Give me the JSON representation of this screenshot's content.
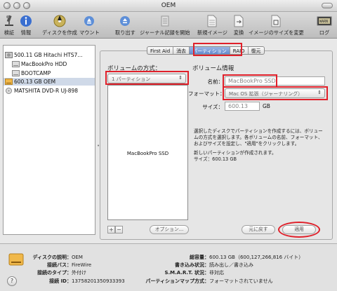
{
  "window": {
    "title": "OEM"
  },
  "toolbar": {
    "items": [
      {
        "label": "検証",
        "icon": "microscope-icon"
      },
      {
        "label": "情報",
        "icon": "info-icon"
      },
      {
        "label": "ディスクを作成",
        "icon": "burn-icon"
      },
      {
        "label": "マウント",
        "icon": "mount-icon"
      },
      {
        "label": "取り出す",
        "icon": "eject-icon"
      },
      {
        "label": "ジャーナル記録を開始",
        "icon": "journal-icon"
      },
      {
        "label": "新規イメージ",
        "icon": "new-image-icon"
      },
      {
        "label": "変換",
        "icon": "convert-icon"
      },
      {
        "label": "イメージのサイズを変更",
        "icon": "resize-image-icon"
      },
      {
        "label": "ログ",
        "icon": "log-icon"
      }
    ]
  },
  "sidebar": {
    "items": [
      {
        "label": "500.11 GB Hitachi HTS7...",
        "icon": "hard-disk-icon",
        "selected": false
      },
      {
        "label": "MacBookPro HDD",
        "icon": "volume-icon",
        "selected": false
      },
      {
        "label": "BOOTCAMP",
        "icon": "volume-icon",
        "selected": false
      },
      {
        "label": "600.13 GB OEM",
        "icon": "external-disk-icon",
        "selected": true
      },
      {
        "label": "MATSHITA DVD-R UJ-898",
        "icon": "optical-drive-icon",
        "selected": false
      }
    ]
  },
  "tabs": [
    {
      "label": "First Aid",
      "active": false
    },
    {
      "label": "消去",
      "active": false
    },
    {
      "label": "パーティション",
      "active": true
    },
    {
      "label": "RAID",
      "active": false
    },
    {
      "label": "復元",
      "active": false
    }
  ],
  "partition": {
    "scheme_heading": "ボリュームの方式：",
    "scheme_value": "1 パーティション",
    "volume_label": "MacBookPro SSD",
    "info_heading": "ボリューム情報",
    "name_label": "名前：",
    "name_value": "MacBookPro SSD",
    "format_label": "フォーマット：",
    "format_value": "Mac OS 拡張（ジャーナリング）",
    "size_label": "サイズ：",
    "size_value": "600.13",
    "size_unit": "GB",
    "help_text_1": "選択したディスクでパーティションを作成するには、ボリュームの方式を選択します。各ボリュームの名前、フォーマット、およびサイズを設定し、\"適用\"をクリックします。",
    "help_text_2": "新しいパーティションが作成されます。\nサイズ：600.13 GB",
    "add_label": "+",
    "remove_label": "−",
    "options_label": "オプション...",
    "revert_label": "元に戻す",
    "apply_label": "適用"
  },
  "disk_info": {
    "description_label": "ディスクの説明：",
    "description_value": "OEM",
    "connection_bus_label": "接続バス：",
    "connection_bus_value": "FireWire",
    "connection_type_label": "接続のタイプ：",
    "connection_type_value": "外付け",
    "connection_id_label": "接続 ID：",
    "connection_id_value": "13758201350933393",
    "capacity_label": "総容量：",
    "capacity_value": "600.13 GB（600,127,266,816 バイト）",
    "write_status_label": "書き込み状況：",
    "write_status_value": "読み出し／書き込み",
    "smart_label": "S.M.A.R.T. 状況：",
    "smart_value": "非対応",
    "partition_map_label": "パーティションマップ方式：",
    "partition_map_value": "フォーマットされていません"
  },
  "help_button": {
    "label": "?"
  },
  "colors": {
    "highlight": "#e0202a",
    "tab_active": "#5f86cc",
    "selection": "#cfd9e8"
  }
}
